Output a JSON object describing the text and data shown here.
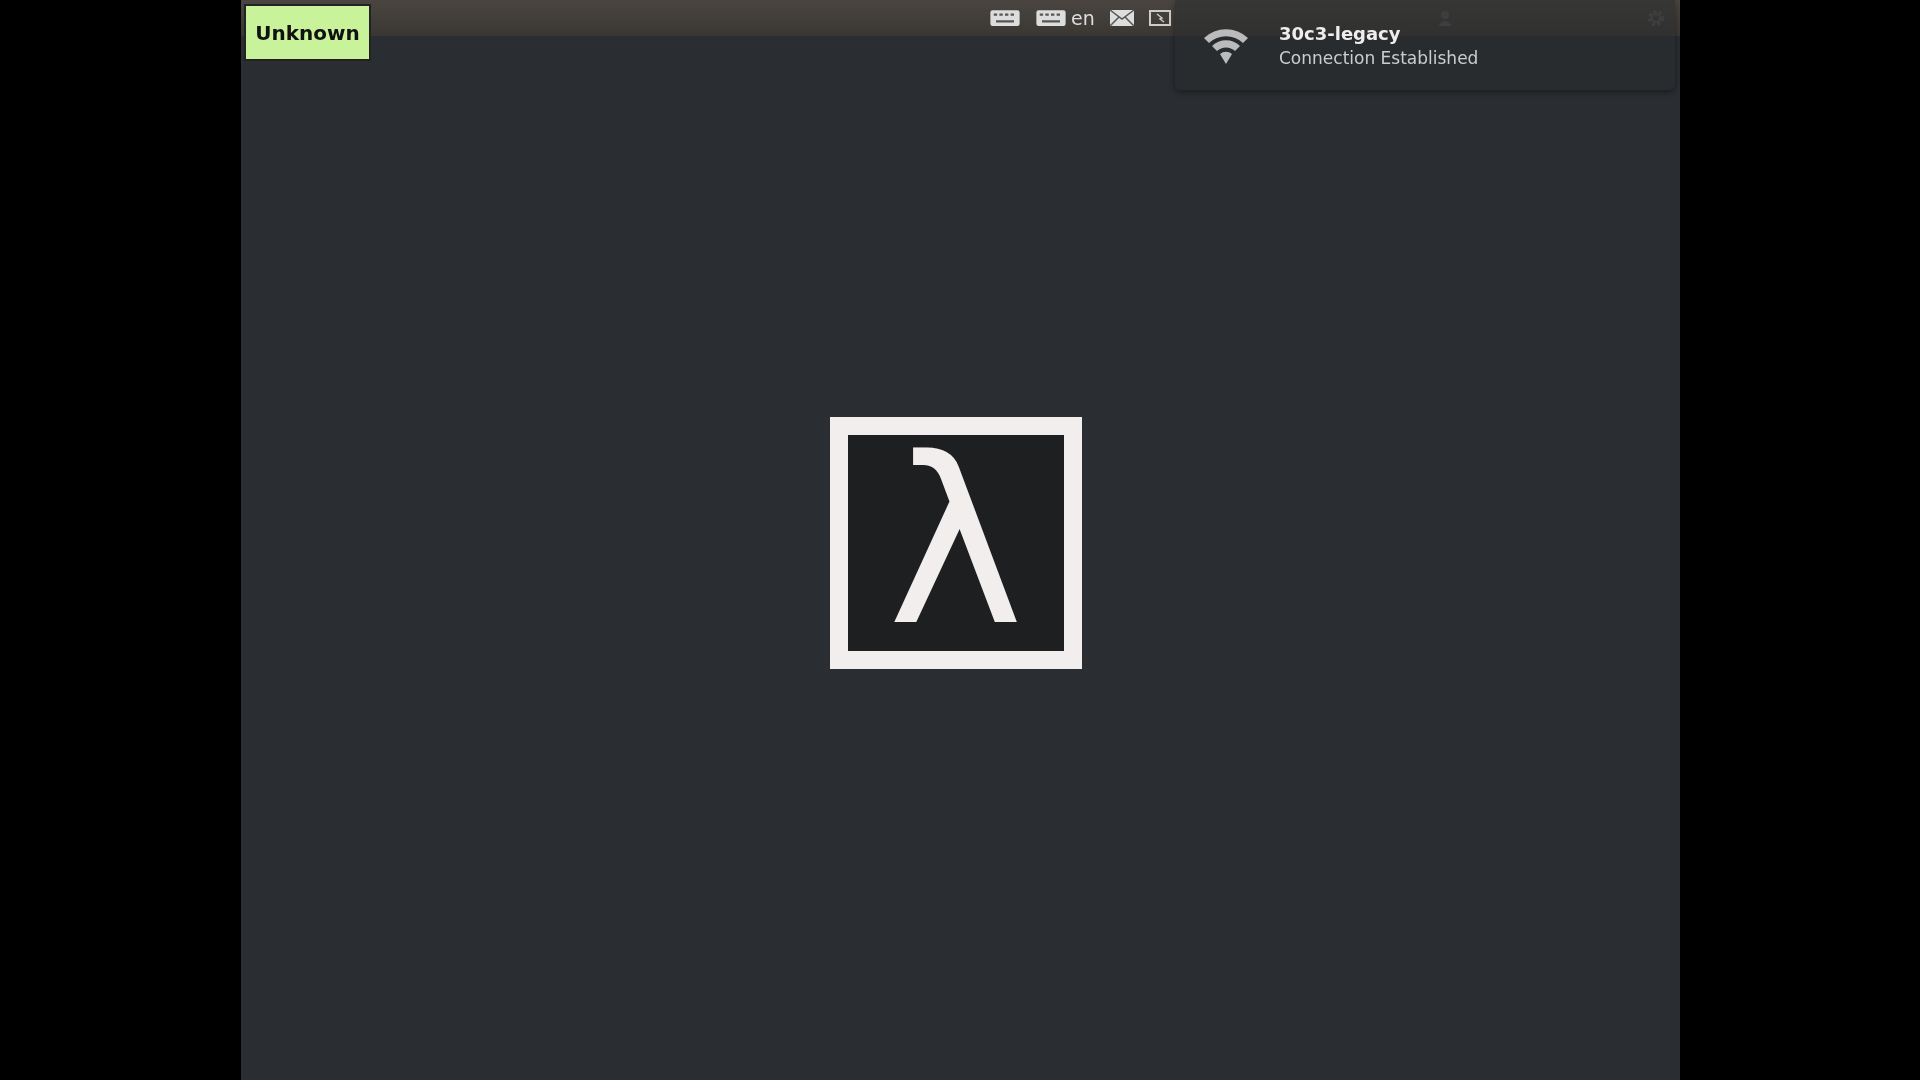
{
  "top_panel": {
    "badge": "Unknown",
    "keyboard_layout": "en"
  },
  "notification": {
    "title": "30c3-legacy",
    "body": "Connection Established"
  },
  "logo": {
    "glyph": "λ"
  }
}
